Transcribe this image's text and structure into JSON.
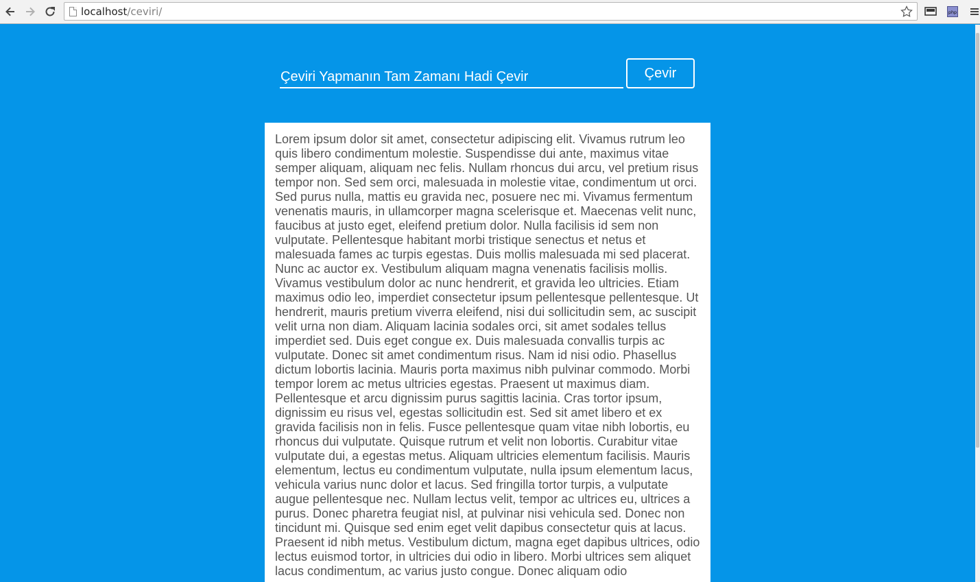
{
  "browser": {
    "url_host": "localhost",
    "url_path": "/ceviri/",
    "icons": [
      "back-arrow-icon",
      "forward-arrow-icon",
      "reload-icon",
      "page-icon",
      "bookmark-star-icon",
      "cast-icon",
      "php-extension-icon",
      "menu-icon"
    ]
  },
  "form": {
    "input_placeholder": "Çeviri Yapmanın Tam Zamanı Hadi Çevir",
    "button_label": "Çevir"
  },
  "result": {
    "text": "Lorem ipsum dolor sit amet, consectetur adipiscing elit. Vivamus rutrum leo quis libero condimentum molestie. Suspendisse dui ante, maximus vitae semper aliquam, aliquam nec felis. Nullam rhoncus dui arcu, vel pretium risus tempor non. Sed sem orci, malesuada in molestie vitae, condimentum ut orci. Sed purus nulla, mattis eu gravida nec, posuere nec mi. Vivamus fermentum venenatis mauris, in ullamcorper magna scelerisque et. Maecenas velit nunc, faucibus at justo eget, eleifend pretium dolor. Nulla facilisis id sem non vulputate. Pellentesque habitant morbi tristique senectus et netus et malesuada fames ac turpis egestas. Duis mollis malesuada mi sed placerat. Nunc ac auctor ex. Vestibulum aliquam magna venenatis facilisis mollis. Vivamus vestibulum dolor ac nunc hendrerit, et gravida leo ultricies. Etiam maximus odio leo, imperdiet consectetur ipsum pellentesque pellentesque. Ut hendrerit, mauris pretium viverra eleifend, nisi dui sollicitudin sem, ac suscipit velit urna non diam. Aliquam lacinia sodales orci, sit amet sodales tellus imperdiet sed. Duis eget congue ex. Duis malesuada convallis turpis ac vulputate. Donec sit amet condimentum risus. Nam id nisi odio. Phasellus dictum lobortis lacinia. Mauris porta maximus nibh pulvinar commodo. Morbi tempor lorem ac metus ultricies egestas. Praesent ut maximus diam. Pellentesque et arcu dignissim purus sagittis lacinia. Cras tortor ipsum, dignissim eu risus vel, egestas sollicitudin est. Sed sit amet libero et ex gravida facilisis non in felis. Fusce pellentesque quam vitae nibh lobortis, eu rhoncus dui vulputate. Quisque rutrum et velit non lobortis. Curabitur vitae vulputate dui, a egestas metus. Aliquam ultricies elementum facilisis. Mauris elementum, lectus eu condimentum vulputate, nulla ipsum elementum lacus, vehicula varius nunc dolor et lacus. Sed fringilla tortor turpis, a vulputate augue pellentesque nec. Nullam lectus velit, tempor ac ultrices eu, ultrices a purus. Donec pharetra feugiat nisl, at pulvinar nisi vehicula sed. Donec non tincidunt mi. Quisque sed enim eget velit dapibus consectetur quis at lacus. Praesent id nibh metus. Vestibulum dictum, magna eget dapibus ultrices, odio lectus euismod tortor, in ultricies dui odio in libero. Morbi ultrices sem aliquet lacus condimentum, ac varius justo congue. Donec aliquam odio"
  },
  "colors": {
    "page_background": "#0595e8",
    "panel_background": "#ffffff",
    "body_text": "#555555",
    "control_foreground": "#ffffff"
  }
}
